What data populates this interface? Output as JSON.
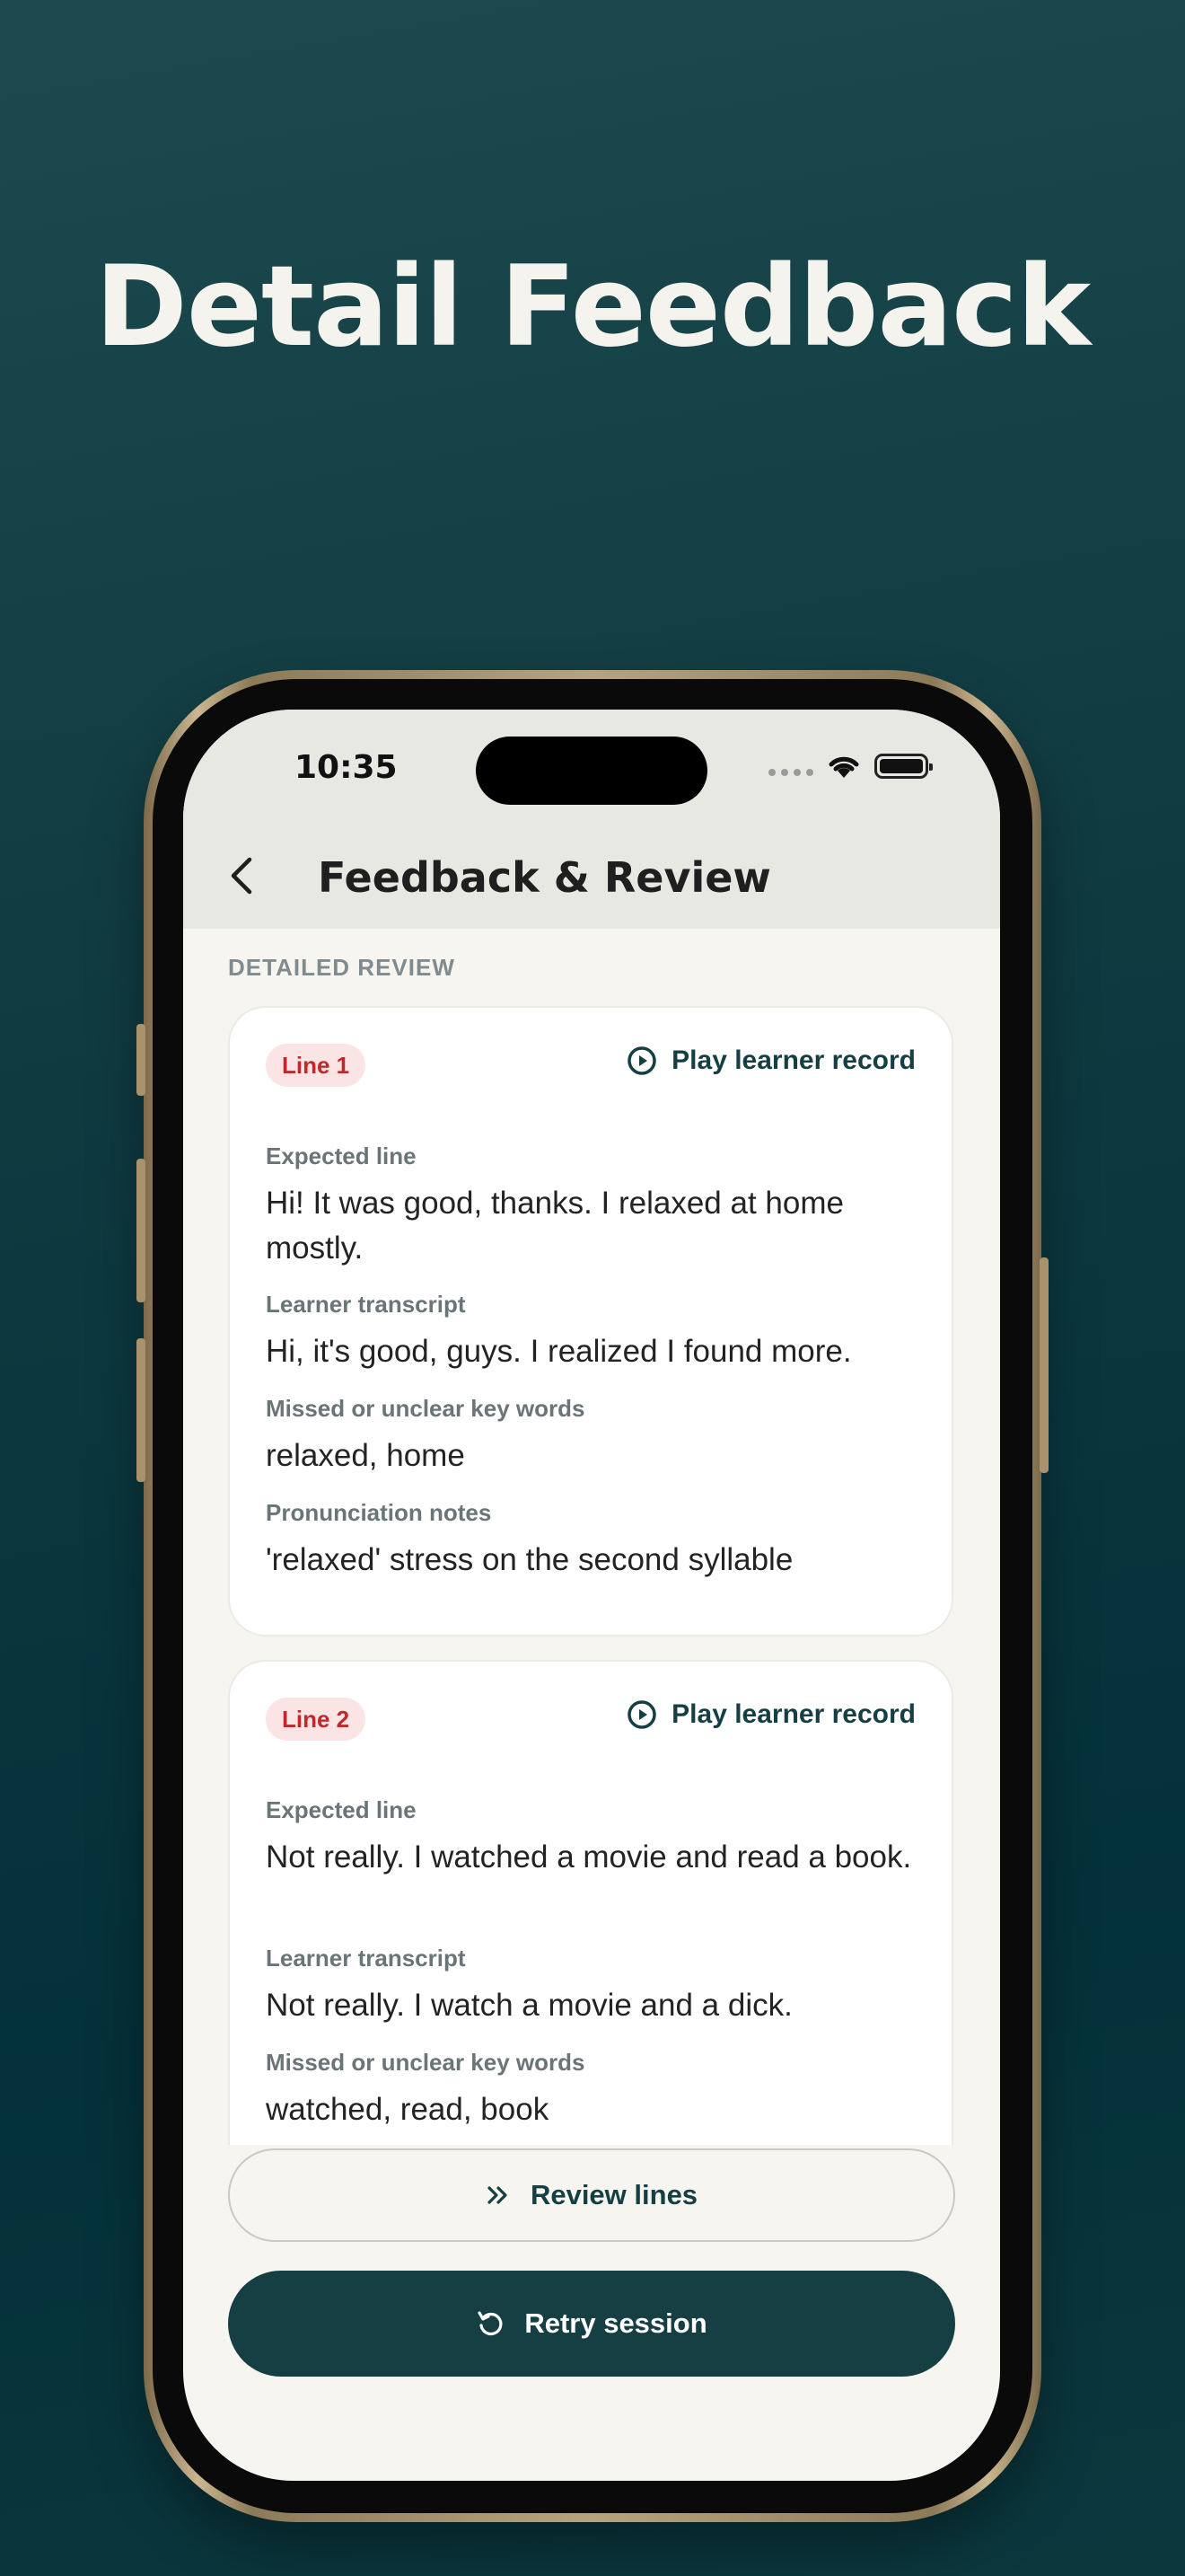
{
  "hero": {
    "title": "Detail Feedback"
  },
  "status_bar": {
    "time": "10:35",
    "icons": [
      "cellular-dots-icon",
      "wifi-icon",
      "battery-icon"
    ]
  },
  "header": {
    "title": "Feedback & Review",
    "back_icon": "chevron-left-icon"
  },
  "section": {
    "label": "DETAILED REVIEW"
  },
  "cards": [
    {
      "badge": "Line 1",
      "play_label": "Play learner record",
      "fields": [
        {
          "label": "Expected line",
          "value": "Hi! It was good, thanks. I relaxed at home mostly."
        },
        {
          "label": "Learner transcript",
          "value": "Hi, it's good, guys. I realized I found more."
        },
        {
          "label": "Missed or unclear key words",
          "value": "relaxed, home"
        },
        {
          "label": "Pronunciation notes",
          "value": "'relaxed' stress on the second syllable"
        }
      ]
    },
    {
      "badge": "Line 2",
      "play_label": "Play learner record",
      "fields": [
        {
          "label": "Expected line",
          "value": "Not really. I watched a movie and read a book."
        },
        {
          "label": "Learner transcript",
          "value": "Not really. I watch a movie and a dick."
        },
        {
          "label": "Missed or unclear key words",
          "value": "watched, read, book"
        }
      ]
    }
  ],
  "actions": {
    "review_label": "Review lines",
    "retry_label": "Retry session"
  },
  "colors": {
    "accent": "#163f44",
    "badge_bg": "#fbe4e4",
    "badge_text": "#c0292b",
    "background_top": "#1d4a4e",
    "background_bottom": "#04313a"
  }
}
